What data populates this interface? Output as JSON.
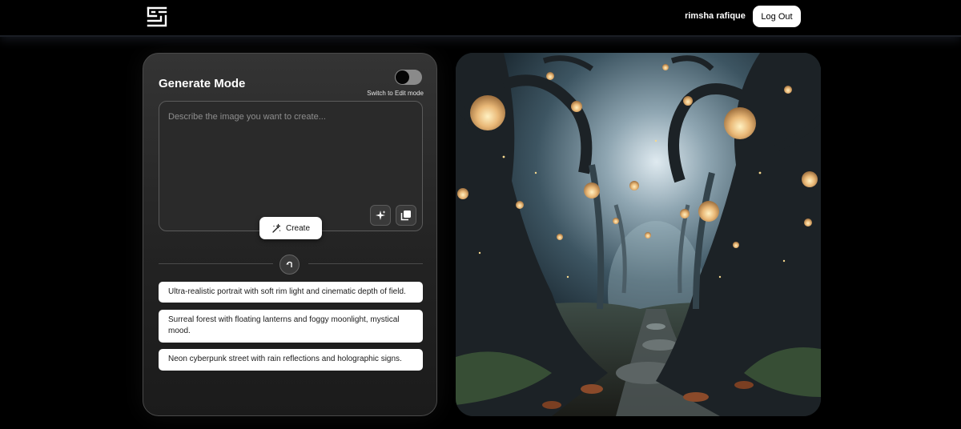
{
  "header": {
    "logo_icon": "maze-logo-icon",
    "user_name": "rimsha rafique",
    "logout_label": "Log Out"
  },
  "generator": {
    "title": "Generate Mode",
    "toggle": {
      "label": "Switch to Edit mode",
      "checked": false
    },
    "prompt": {
      "placeholder": "Describe the image you want to create...",
      "value": ""
    },
    "enhance_icon": "sparkle-icon",
    "copy_icon": "copy-icon",
    "create_label": "Create",
    "create_icon": "wand-icon",
    "refresh_icon": "refresh-icon",
    "suggestions": [
      "Ultra-realistic portrait with soft rim light and cinematic depth of field.",
      "Surreal forest with floating lanterns and foggy moonlight, mystical mood.",
      "Neon cyberpunk street with rain reflections and holographic signs."
    ]
  },
  "preview": {
    "image_description": "generated-forest-image"
  },
  "colors": {
    "background": "#000000",
    "panel": "#2a2a2a",
    "accent_button": "#ffffff",
    "toggle_track": "#8a8a8a"
  }
}
